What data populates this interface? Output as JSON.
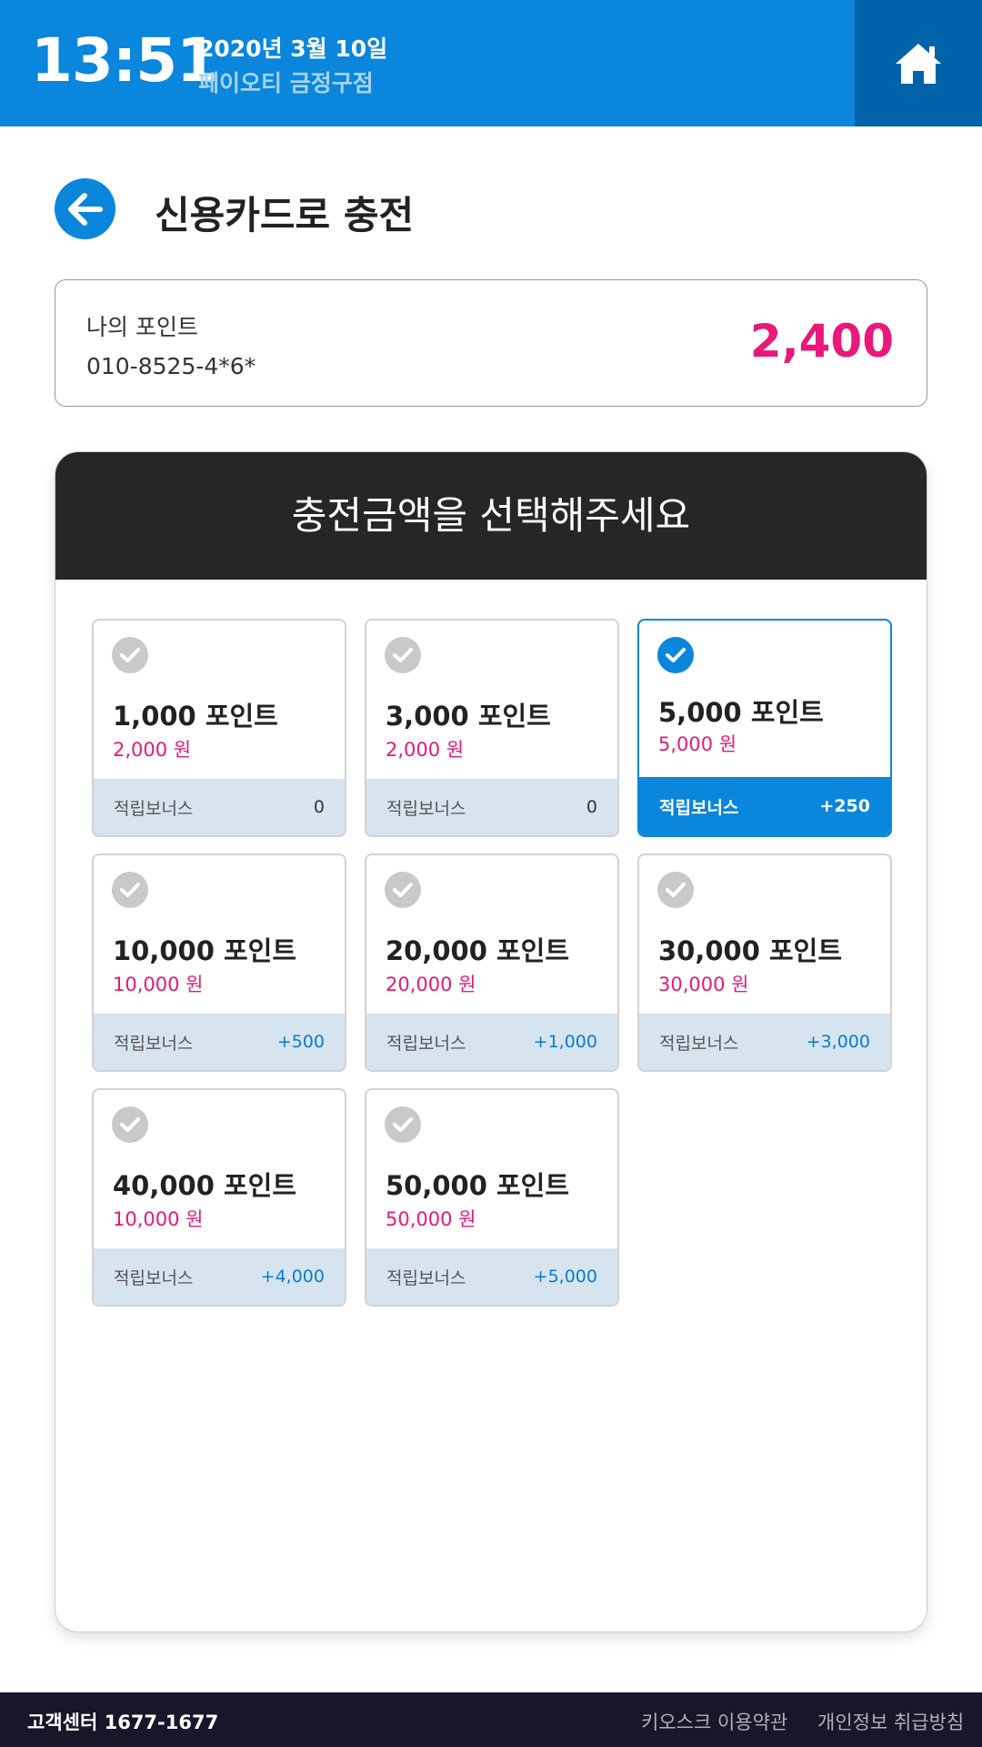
{
  "header": {
    "time": "13:51",
    "date": "2020년 3월 10일",
    "store": "페이오티 금정구점",
    "home_icon": "home-icon"
  },
  "page": {
    "title": "신용카드로 충전",
    "back_icon": "arrow-left-icon"
  },
  "points": {
    "label": "나의 포인트",
    "phone": "010-8525-4*6*",
    "value": "2,400"
  },
  "selection": {
    "heading": "충전금액을 선택해주세요",
    "cards": [
      {
        "title": "1,000 포인트",
        "price": "2,000 원",
        "bonus_label": "적립보너스",
        "bonus": "0",
        "selected": false
      },
      {
        "title": "3,000 포인트",
        "price": "2,000 원",
        "bonus_label": "적립보너스",
        "bonus": "0",
        "selected": false
      },
      {
        "title": "5,000 포인트",
        "price": "5,000 원",
        "bonus_label": "적립보너스",
        "bonus": "+250",
        "selected": true
      },
      {
        "title": "10,000 포인트",
        "price": "10,000 원",
        "bonus_label": "적립보너스",
        "bonus": "+500",
        "selected": false
      },
      {
        "title": "20,000 포인트",
        "price": "20,000 원",
        "bonus_label": "적립보너스",
        "bonus": "+1,000",
        "selected": false
      },
      {
        "title": "30,000 포인트",
        "price": "30,000 원",
        "bonus_label": "적립보너스",
        "bonus": "+3,000",
        "selected": false
      },
      {
        "title": "40,000 포인트",
        "price": "10,000 원",
        "bonus_label": "적립보너스",
        "bonus": "+4,000",
        "selected": false
      },
      {
        "title": "50,000 포인트",
        "price": "50,000 원",
        "bonus_label": "적립보너스",
        "bonus": "+5,000",
        "selected": false
      }
    ]
  },
  "footer": {
    "customer_center": "고객센터 1677-1677",
    "terms": "키오스크 이용약관",
    "privacy": "개인정보 취급방침"
  },
  "colors": {
    "primary": "#0a86dc",
    "primary_dark": "#0062a8",
    "accent_pink": "#e8197a",
    "panel_header": "#262626",
    "footer_bg": "#171729"
  }
}
